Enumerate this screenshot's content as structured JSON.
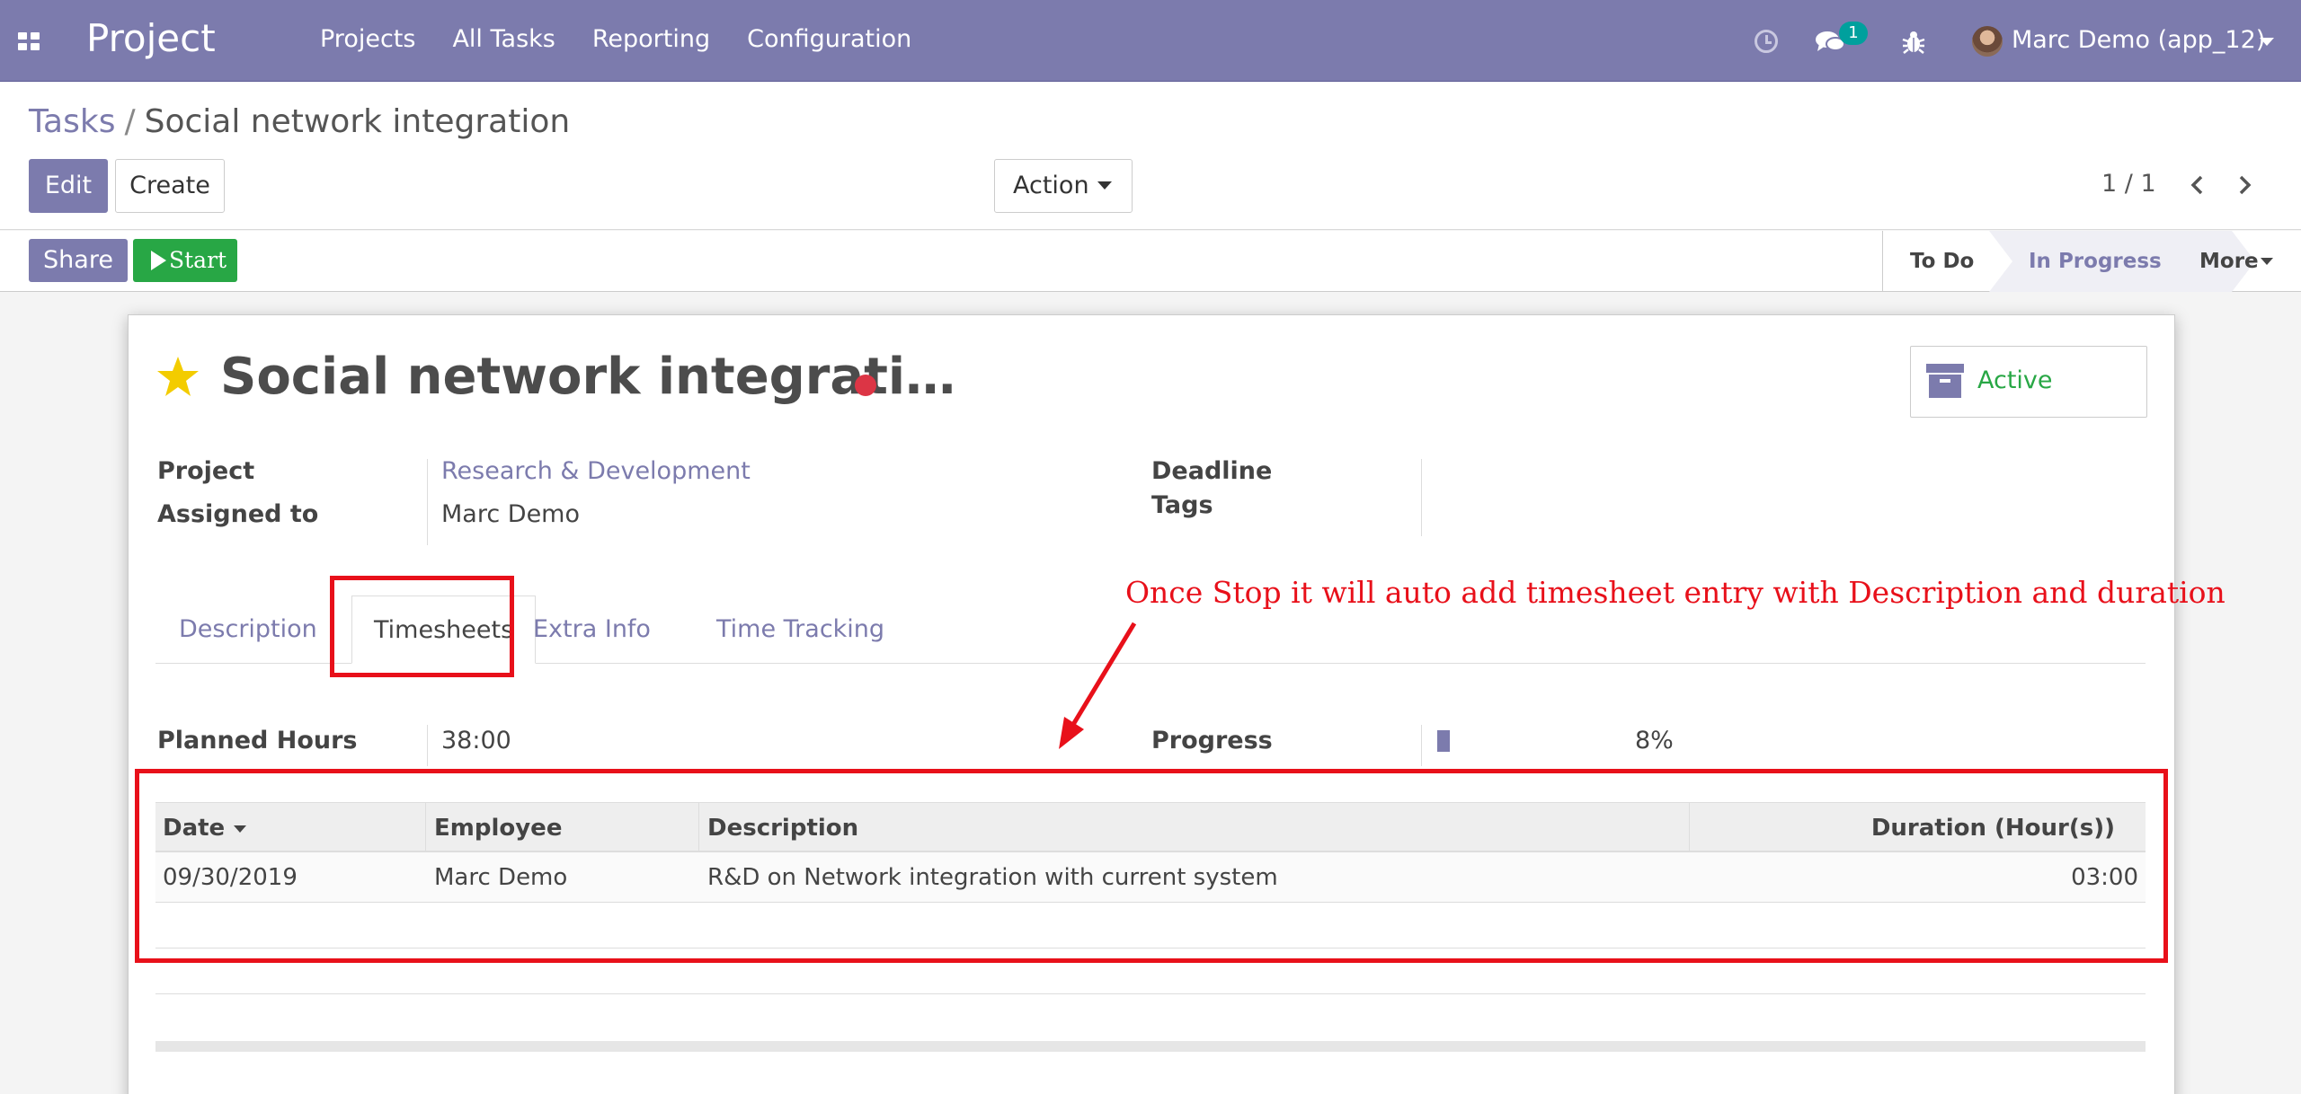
{
  "navbar": {
    "brand": "Project",
    "menu": [
      "Projects",
      "All Tasks",
      "Reporting",
      "Configuration"
    ],
    "messages_badge": "1",
    "user": "Marc Demo (app_12)",
    "color": "#7c7bad"
  },
  "breadcrumb": {
    "parent": "Tasks",
    "separator": "/",
    "current": "Social network integration"
  },
  "buttons": {
    "edit": "Edit",
    "create": "Create",
    "action": "Action",
    "share": "Share",
    "start": "Start"
  },
  "pager": {
    "value": "1 / 1"
  },
  "stages": {
    "todo": "To Do",
    "in_progress": "In Progress",
    "more": "More"
  },
  "record": {
    "title": "Social network integrati…",
    "active_label": "Active",
    "fields": {
      "project_label": "Project",
      "project_value": "Research & Development",
      "assigned_label": "Assigned to",
      "assigned_value": "Marc Demo",
      "deadline_label": "Deadline",
      "tags_label": "Tags",
      "planned_label": "Planned Hours",
      "planned_value": "38:00",
      "progress_label": "Progress",
      "progress_value": "8%",
      "progress_fraction": 0.08
    },
    "tabs": [
      "Description",
      "Timesheets",
      "Extra Info",
      "Time Tracking"
    ],
    "active_tab": "Timesheets"
  },
  "timesheet": {
    "columns": [
      "Date",
      "Employee",
      "Description",
      "Duration (Hour(s))"
    ],
    "rows": [
      {
        "date": "09/30/2019",
        "employee": "Marc Demo",
        "description": "R&D on Network integration with current system",
        "duration": "03:00"
      }
    ]
  },
  "annotation": {
    "text": "Once Stop it will auto add timesheet entry with Description and duration",
    "color": "#e8101a"
  }
}
